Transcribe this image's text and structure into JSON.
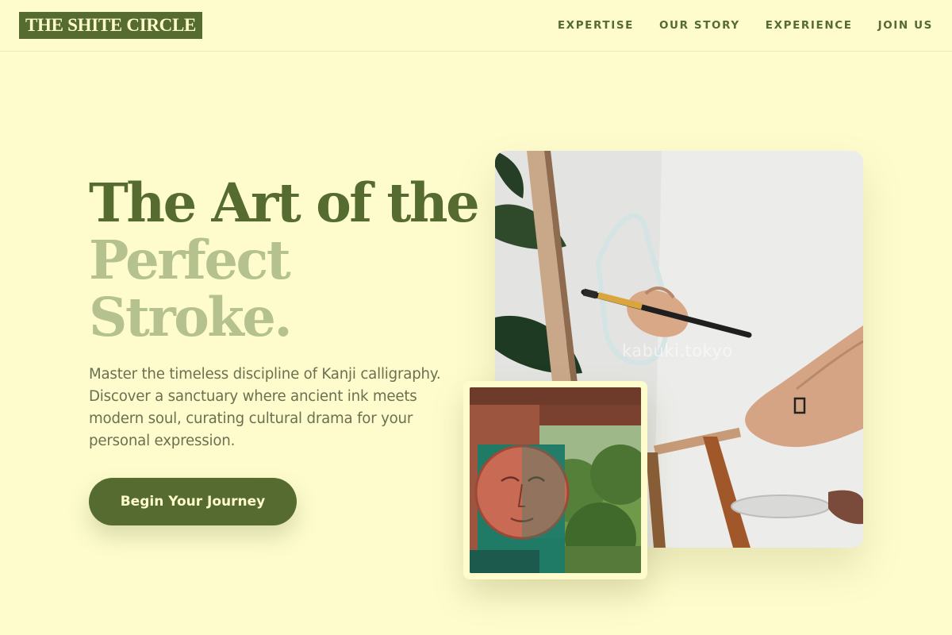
{
  "brand": {
    "name": "THE SHITE CIRCLE"
  },
  "nav": {
    "items": [
      {
        "label": "EXPERTISE"
      },
      {
        "label": "OUR STORY"
      },
      {
        "label": "EXPERIENCE"
      },
      {
        "label": "JOIN US"
      }
    ]
  },
  "hero": {
    "title_line1": "The Art of the",
    "title_line2": "Perfect",
    "title_line3": "Stroke.",
    "subtitle": "Master the timeless discipline of Kanji calligraphy. Discover a sanctuary where ancient ink meets modern soul, curating cultural drama for your personal expression.",
    "cta_label": "Begin Your Journey"
  },
  "gallery": {
    "main_image": {
      "icon": "painting-at-easel-photo",
      "watermark": "kabuki.tokyo"
    },
    "secondary_image": {
      "icon": "mural-face-photo"
    }
  },
  "colors": {
    "background": "#fefccd",
    "primary": "#556b2f",
    "accent_light": "#b5c28f",
    "body_text": "#6b7050"
  }
}
